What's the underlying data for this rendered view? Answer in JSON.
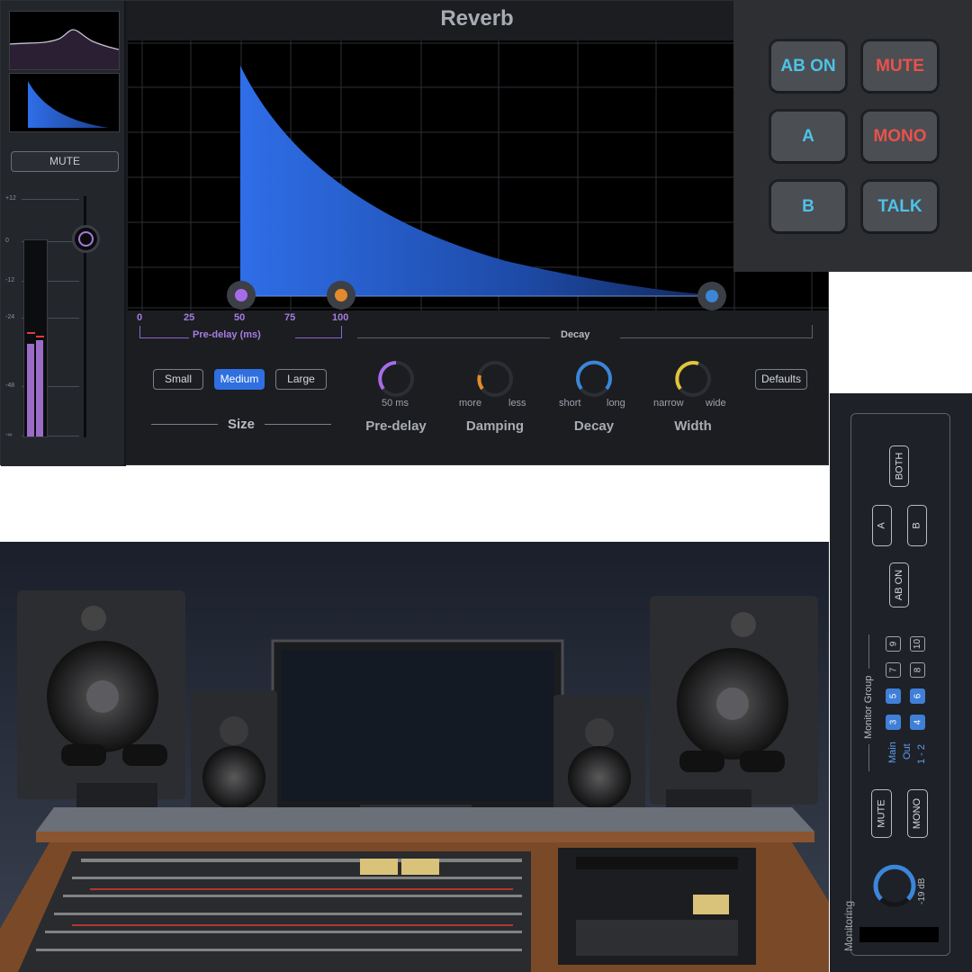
{
  "reverb": {
    "title": "Reverb",
    "sidebar": {
      "mute_label": "MUTE",
      "meter_scale": [
        "+12",
        "0",
        "-12",
        "-24",
        "-48",
        "-∞"
      ]
    },
    "graph": {
      "x_ticks": [
        "0",
        "25",
        "50",
        "75",
        "100"
      ],
      "predelay_label": "Pre-delay (ms)",
      "decay_label": "Decay",
      "handle_colors": {
        "predelay": "#a66ce8",
        "damping": "#e58a2a",
        "decay": "#3b86d8"
      }
    },
    "size": {
      "label": "Size",
      "options": [
        "Small",
        "Medium",
        "Large"
      ],
      "selected": "Medium"
    },
    "knobs": {
      "predelay": {
        "title": "Pre-delay",
        "value_text": "50 ms",
        "color": "#a66ce8"
      },
      "damping": {
        "title": "Damping",
        "left": "more",
        "right": "less",
        "color": "#e58a2a"
      },
      "decay": {
        "title": "Decay",
        "left": "short",
        "right": "long",
        "color": "#3b86d8"
      },
      "width": {
        "title": "Width",
        "left": "narrow",
        "right": "wide",
        "color": "#e2c53a"
      }
    },
    "defaults_label": "Defaults"
  },
  "hardware": {
    "buttons": [
      {
        "label": "AB ON",
        "color": "blue"
      },
      {
        "label": "MUTE",
        "color": "red"
      },
      {
        "label": "A",
        "color": "blue"
      },
      {
        "label": "MONO",
        "color": "red"
      },
      {
        "label": "B",
        "color": "blue"
      },
      {
        "label": "TALK",
        "color": "blue"
      }
    ]
  },
  "monitoring": {
    "title": "Monitoring",
    "both_label": "BOTH",
    "a_label": "A",
    "b_label": "B",
    "ab_on_label": "AB ON",
    "group_label": "Monitor Group",
    "main_out": [
      "Main",
      "Out",
      "1 - 2"
    ],
    "numbers": [
      "3",
      "4",
      "5",
      "6",
      "7",
      "8",
      "9",
      "10"
    ],
    "active_numbers": [
      "3",
      "4",
      "5",
      "6"
    ],
    "mute_label": "MUTE",
    "mono_label": "MONO",
    "level": "-19 dB"
  }
}
